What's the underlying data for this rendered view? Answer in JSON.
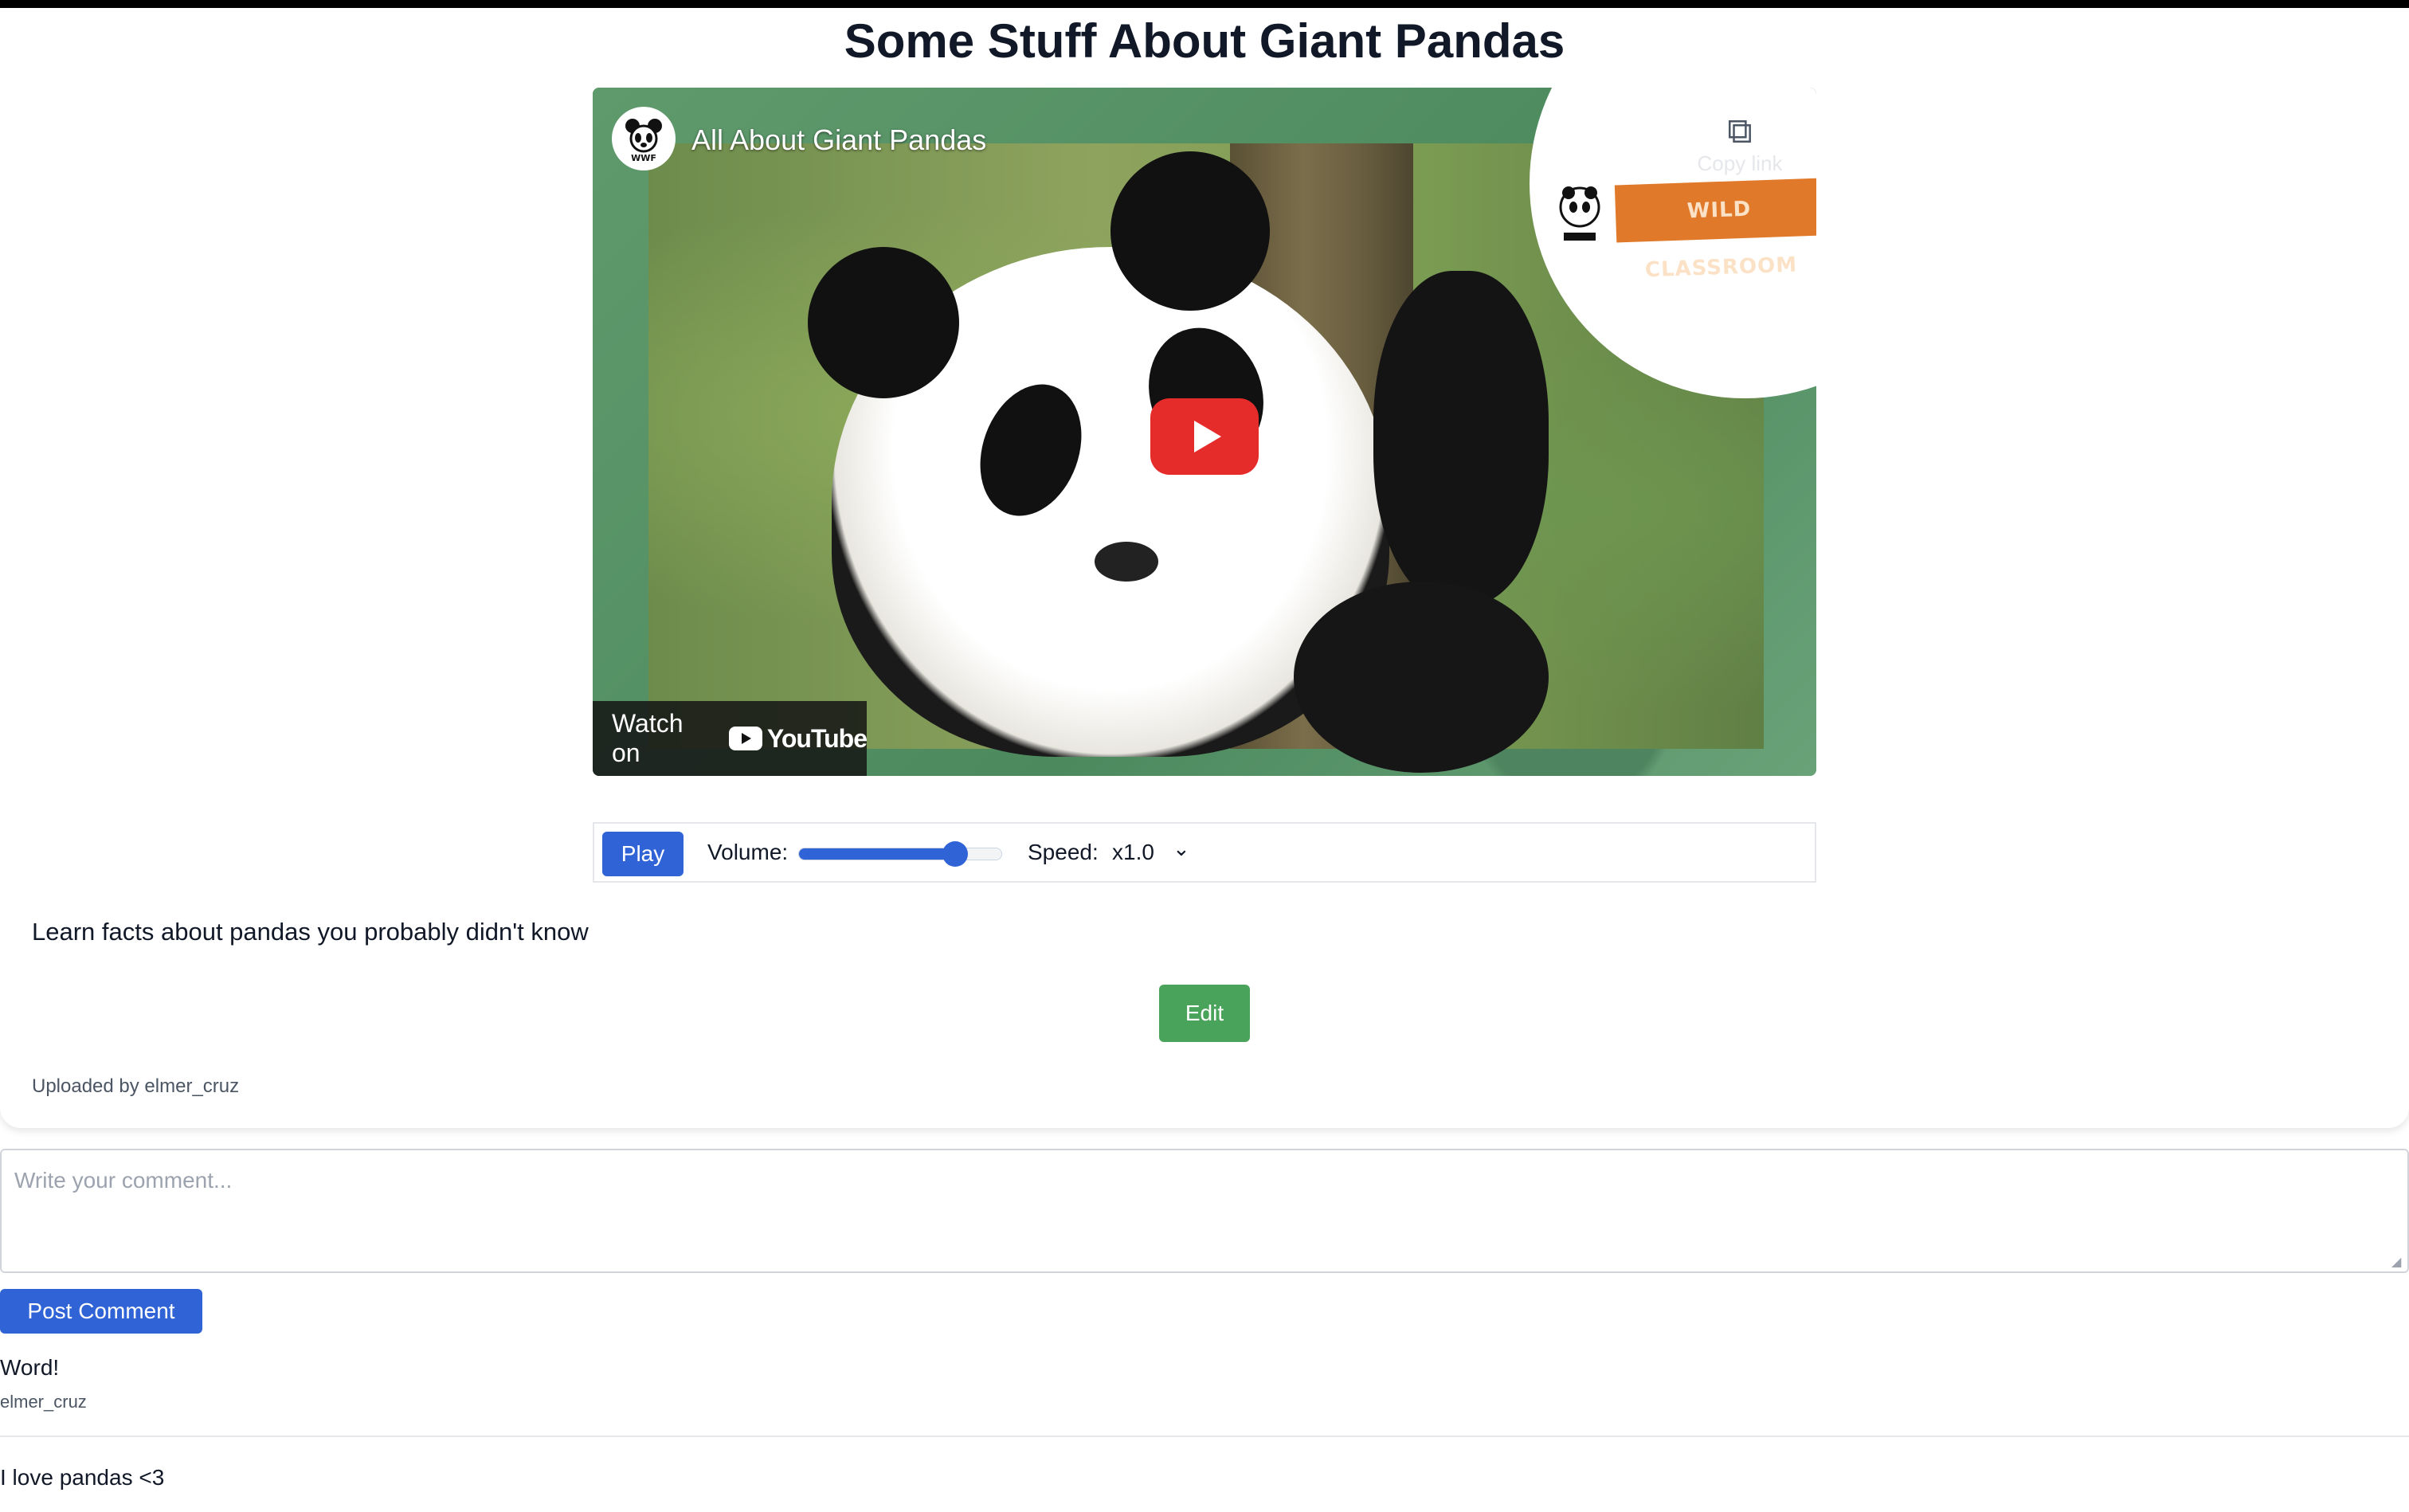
{
  "page": {
    "title": "Some Stuff About Giant Pandas"
  },
  "video": {
    "title": "All About Giant Pandas",
    "channel_logo_icon": "panda-logo-icon",
    "channel_logo_text": "WWF",
    "overlay_brand": "WILD CLASSROOM",
    "copy_link_label": "Copy link",
    "watch_on_label": "Watch on",
    "youtube_label": "YouTube",
    "play_overlay_icon": "play-icon"
  },
  "controls": {
    "play_label": "Play",
    "volume_label": "Volume:",
    "volume_level": 0.77,
    "speed_label": "Speed:",
    "speed_value": "x1.0"
  },
  "description": "Learn facts about pandas you probably didn't know",
  "edit_label": "Edit",
  "uploaded_by": "Uploaded by elmer_cruz",
  "comment_form": {
    "placeholder": "Write your comment...",
    "post_label": "Post Comment"
  },
  "comments": [
    {
      "text": "Word!",
      "author": "elmer_cruz"
    },
    {
      "text": "I love pandas <3",
      "author": ""
    }
  ],
  "colors": {
    "primary": "#2f63d6",
    "edit": "#4aa35a",
    "youtube_red": "#e62b2b",
    "brand_orange": "#e07a2a"
  }
}
